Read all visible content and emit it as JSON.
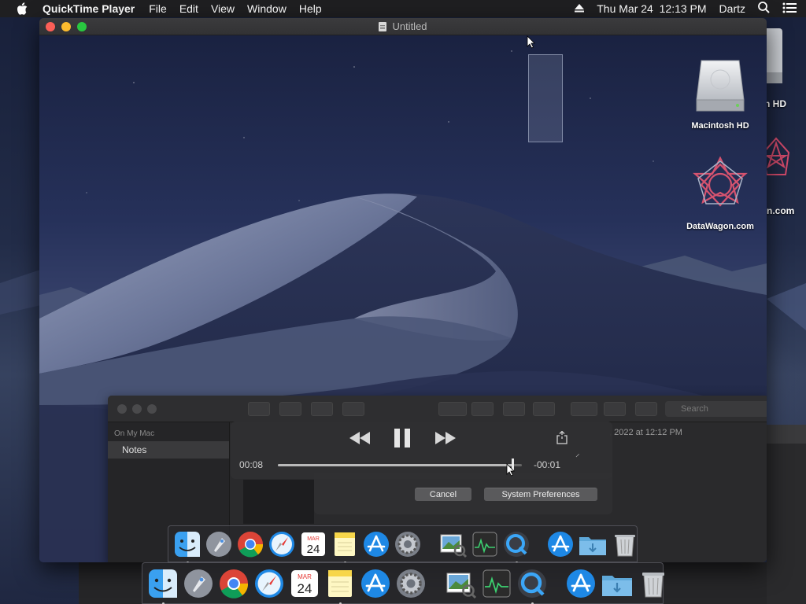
{
  "menubar": {
    "app_name": "QuickTime Player",
    "menus": [
      "File",
      "Edit",
      "View",
      "Window",
      "Help"
    ],
    "datetime": "Thu Mar 24  12:13 PM",
    "user": "Dartz"
  },
  "outer_desktop": {
    "icons": [
      {
        "label": "n HD"
      },
      {
        "label": "n.com"
      }
    ]
  },
  "qt_window": {
    "title": "Untitled"
  },
  "inner_desktop": {
    "icons": [
      {
        "label": "Macintosh HD",
        "icon": "hard-drive-icon"
      },
      {
        "label": "DataWagon.com",
        "icon": "datawagon-icon"
      }
    ]
  },
  "notes": {
    "sidebar_header": "On My Mac",
    "sidebar_item": "Notes",
    "search_placeholder": "Search",
    "note_date": ", 2022 at 12:12 PM"
  },
  "player": {
    "elapsed": "00:08",
    "remaining": "-00:01",
    "progress": 0.96,
    "cancel_label": "Cancel",
    "sys_prefs_label": "System Preferences"
  },
  "dock": {
    "apps": [
      {
        "name": "finder",
        "icon": "finder-icon",
        "running": true
      },
      {
        "name": "launchpad",
        "icon": "launchpad-icon",
        "running": false
      },
      {
        "name": "chrome",
        "icon": "chrome-icon",
        "running": false
      },
      {
        "name": "safari",
        "icon": "safari-icon",
        "running": false
      },
      {
        "name": "calendar",
        "icon": "calendar-icon",
        "running": false,
        "month": "MAR",
        "day": "24"
      },
      {
        "name": "notes",
        "icon": "notes-icon",
        "running": true
      },
      {
        "name": "app-store",
        "icon": "app-store-icon",
        "running": false
      },
      {
        "name": "system-preferences",
        "icon": "system-preferences-icon",
        "running": false
      }
    ],
    "recent": [
      {
        "name": "preview",
        "icon": "preview-icon"
      },
      {
        "name": "activity-monitor",
        "icon": "activity-monitor-icon"
      },
      {
        "name": "quicktime",
        "icon": "quicktime-icon",
        "running": true
      }
    ],
    "other": [
      {
        "name": "app-store-folder",
        "icon": "app-store-icon"
      },
      {
        "name": "downloads-folder",
        "icon": "folder-icon"
      },
      {
        "name": "trash",
        "icon": "trash-icon"
      }
    ]
  },
  "colors": {
    "close": "#fc5f57",
    "minimize": "#fdbc2e",
    "maximize": "#29c840",
    "menubar_bg": "#1f1f21"
  }
}
